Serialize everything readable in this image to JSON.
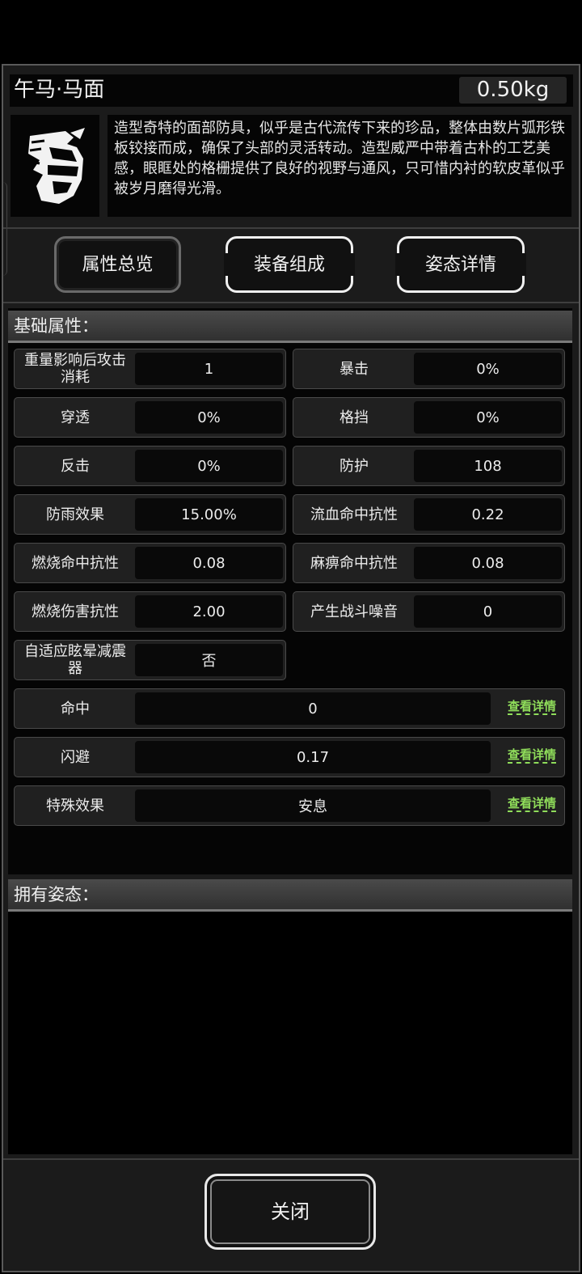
{
  "item": {
    "name": "午马·马面",
    "weight": "0.50kg",
    "icon": "horse-head-icon",
    "description": "造型奇特的面部防具，似乎是古代流传下来的珍品，整体由数片弧形铁板铰接而成，确保了头部的灵活转动。造型威严中带着古朴的工艺美感，眼眶处的格栅提供了良好的视野与通风，只可惜内衬的软皮革似乎被岁月磨得光滑。"
  },
  "tabs": [
    {
      "label": "属性总览"
    },
    {
      "label": "装备组成"
    },
    {
      "label": "姿态详情"
    }
  ],
  "basic": {
    "title": "基础属性：",
    "stats": [
      {
        "label": "重量影响后攻击消耗",
        "value": "1"
      },
      {
        "label": "暴击",
        "value": "0%"
      },
      {
        "label": "穿透",
        "value": "0%"
      },
      {
        "label": "格挡",
        "value": "0%"
      },
      {
        "label": "反击",
        "value": "0%"
      },
      {
        "label": "防护",
        "value": "108"
      },
      {
        "label": "防雨效果",
        "value": "15.00%"
      },
      {
        "label": "流血命中抗性",
        "value": "0.22"
      },
      {
        "label": "燃烧命中抗性",
        "value": "0.08"
      },
      {
        "label": "麻痹命中抗性",
        "value": "0.08"
      },
      {
        "label": "燃烧伤害抗性",
        "value": "2.00"
      },
      {
        "label": "产生战斗噪音",
        "value": "0"
      },
      {
        "label": "自适应眩晕减震器",
        "value": "否"
      }
    ],
    "wide": [
      {
        "label": "命中",
        "value": "0",
        "link": "查看详情"
      },
      {
        "label": "闪避",
        "value": "0.17",
        "link": "查看详情"
      },
      {
        "label": "特殊效果",
        "value": "安息",
        "link": "查看详情"
      }
    ]
  },
  "owned": {
    "title": "拥有姿态："
  },
  "close_label": "关闭",
  "colors": {
    "accent_link": "#8fdc5a",
    "panel": "#1b1b1b",
    "cell": "#202020"
  }
}
